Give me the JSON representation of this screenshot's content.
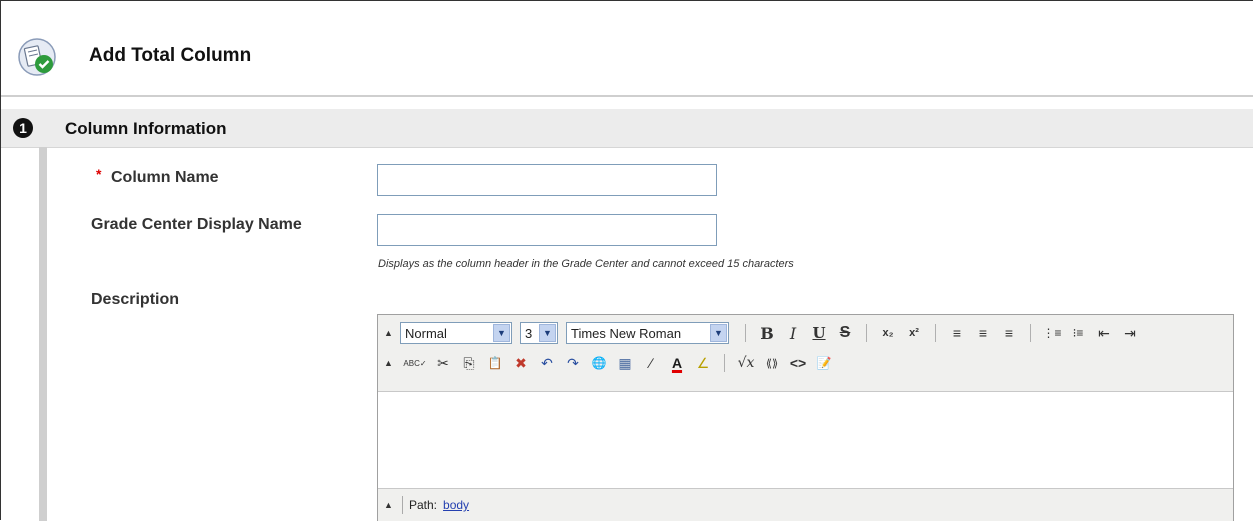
{
  "header": {
    "title": "Add Total Column",
    "icon": "column-check-icon"
  },
  "section": {
    "step": "1",
    "title": "Column Information"
  },
  "form": {
    "column_name": {
      "label": "Column Name",
      "required_mark": "*",
      "value": ""
    },
    "display_name": {
      "label": "Grade Center Display Name",
      "value": "",
      "hint": "Displays as the column header in the Grade Center and cannot exceed 15 characters"
    },
    "description": {
      "label": "Description"
    }
  },
  "editor": {
    "format_select": "Normal",
    "size_select": "3",
    "font_select": "Times New Roman",
    "buttons": {
      "bold": "B",
      "italic": "I",
      "underline": "U",
      "strike": "S",
      "subscript": "x₂",
      "superscript": "x²",
      "align_left": "≡",
      "align_center": "≡",
      "align_right": "≡",
      "ordered_list": "⋮≡",
      "unordered_list": "⁝≡",
      "outdent": "⇤",
      "indent": "⇥",
      "spellcheck": "ABC✓",
      "cut": "✂",
      "copy": "⎘",
      "paste": "📋",
      "clear_format": "✖",
      "undo": "↶",
      "redo": "↷",
      "link": "🌐",
      "table": "▦",
      "draw": "∕",
      "text_color": "A",
      "highlight": "∠",
      "math": "√x",
      "anchor": "⟪⟫",
      "html": "<>",
      "preview": "📝"
    },
    "path_label": "Path:",
    "path_value": "body"
  },
  "colors": {
    "section_bg": "#ececec",
    "link": "#2540b0",
    "required": "#dd0000"
  }
}
